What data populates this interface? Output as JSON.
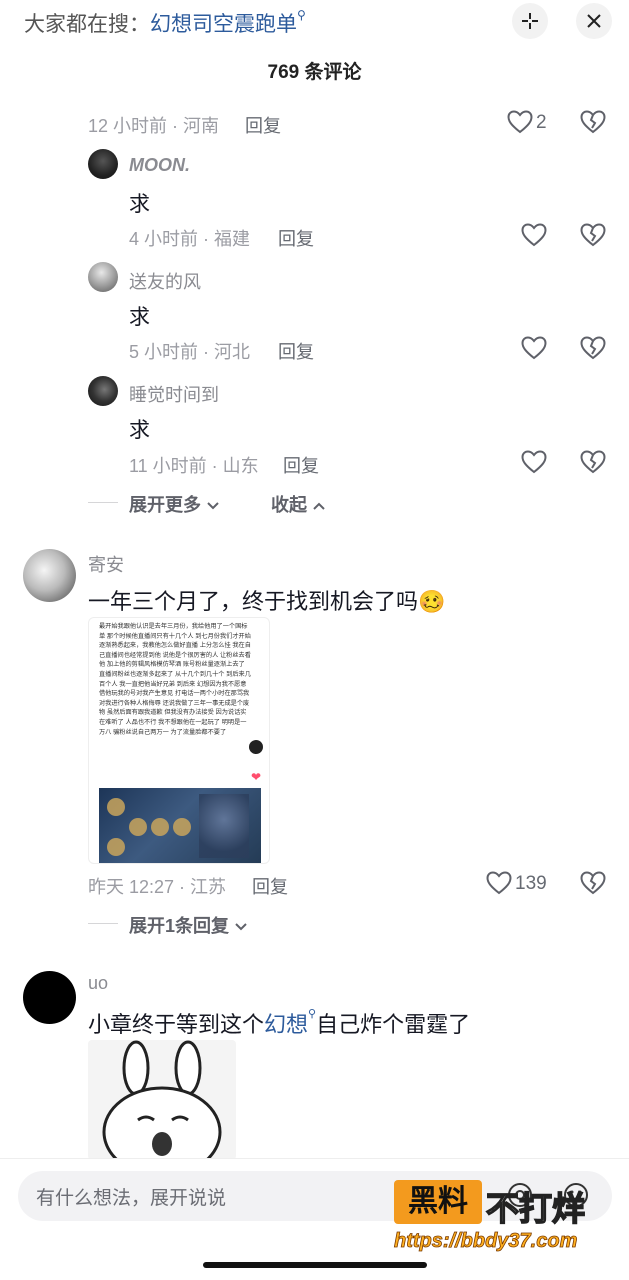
{
  "header": {
    "search_prefix": "大家都在搜：",
    "search_keyword": "幻想司空震跑单",
    "count_label": "769 条评论"
  },
  "top_comment_meta": {
    "time_location": "12 小时前 · 河南",
    "reply": "回复",
    "likes": "2"
  },
  "sub_replies": [
    {
      "name": "MOON.",
      "text": "求",
      "time_location": "4 小时前 · 福建",
      "reply": "回复"
    },
    {
      "name": "送友的风",
      "text": "求",
      "time_location": "5 小时前 · 河北",
      "reply": "回复"
    },
    {
      "name": "睡觉时间到",
      "text": "求",
      "time_location": "11 小时前 · 山东",
      "reply": "回复"
    }
  ],
  "expand_more": "展开更多",
  "collapse": "收起",
  "comment_2": {
    "name": "寄安",
    "text": "一年三个月了，终于找到机会了吗",
    "emoji": "🥴",
    "attachment_text": "最开始我跟他认识是去年三月份，我给他用了一个国标单 那个时候他直播间只有十几个人 到七月份我们才开始逐渐熟悉起来，我教他怎么做好直播 上分怎么挂 我在自己直播间也经常提到他 说他是个很厉害的人 让粉丝去看他 加上他的剪辑风格模仿琴酒 账号粉丝量逐渐上去了 直播间粉丝也逐渐多起来了 从十几个到几十个 到后来几百个人 我一直把他当好兄弟 到后来 幻想因为我不愿意借他玩我的号对我产生意见 打电话一两个小时在那骂我 对我进行各种人格侮辱 还说我做了三年一事无成是个废物 虽然后面有跟我道歉 但我没有办法接受 因为说话实在难听了 人品也不行 我不想跟他在一起玩了 明明是一万八 骗粉丝说自己两万一 为了流量脸都不要了",
    "time_location": "昨天 12:27 · 江苏",
    "reply": "回复",
    "likes": "139",
    "expand_replies": "展开1条回复"
  },
  "comment_3": {
    "name": "uo",
    "text_before": "小章终于等到这个",
    "keyword": "幻想",
    "text_after": "自己炸个雷霆了"
  },
  "input": {
    "placeholder": "有什么想法，展开说说"
  },
  "watermark": {
    "box": "黑料",
    "text": "不打烊",
    "url": "https://bbdy37.com"
  }
}
